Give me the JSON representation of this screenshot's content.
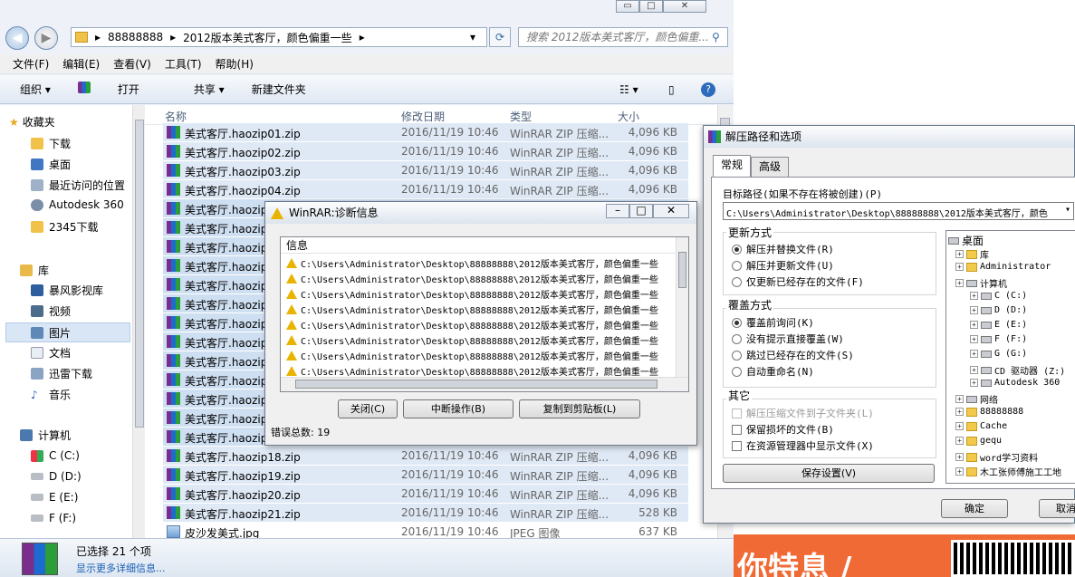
{
  "explorer": {
    "win_buttons": [
      "▭",
      "□",
      "✕"
    ],
    "address": [
      "88888888",
      "2012版本美式客厅，颜色偏重一些"
    ],
    "search_placeholder": "搜索 2012版本美式客厅，颜色偏重...",
    "menu": [
      "文件(F)",
      "编辑(E)",
      "查看(V)",
      "工具(T)",
      "帮助(H)"
    ],
    "toolbar": [
      "组织 ▾",
      "打开",
      "共享 ▾",
      "新建文件夹"
    ],
    "nav": {
      "favorites_label": "收藏夹",
      "favorites": [
        "下载",
        "桌面",
        "最近访问的位置",
        "Autodesk 360",
        "2345下载"
      ],
      "libraries_label": "库",
      "libraries": [
        "暴风影视库",
        "视频",
        "图片",
        "文档",
        "迅雷下载",
        "音乐"
      ],
      "computer_label": "计算机",
      "drives": [
        "C (C:)",
        "D (D:)",
        "E (E:)",
        "F (F:)"
      ]
    },
    "columns": [
      "名称",
      "修改日期",
      "类型",
      "大小"
    ],
    "files": [
      {
        "name": "美式客厅.haozip01.zip",
        "date": "2016/11/19 10:46",
        "type": "WinRAR ZIP 压缩...",
        "size": "4,096 KB"
      },
      {
        "name": "美式客厅.haozip02.zip",
        "date": "2016/11/19 10:46",
        "type": "WinRAR ZIP 压缩...",
        "size": "4,096 KB"
      },
      {
        "name": "美式客厅.haozip03.zip",
        "date": "2016/11/19 10:46",
        "type": "WinRAR ZIP 压缩...",
        "size": "4,096 KB"
      },
      {
        "name": "美式客厅.haozip04.zip",
        "date": "2016/11/19 10:46",
        "type": "WinRAR ZIP 压缩...",
        "size": "4,096 KB"
      },
      {
        "name": "美式客厅.haozip",
        "date": "",
        "type": "",
        "size": ""
      },
      {
        "name": "美式客厅.haozip",
        "date": "",
        "type": "",
        "size": ""
      },
      {
        "name": "美式客厅.haozip",
        "date": "",
        "type": "",
        "size": ""
      },
      {
        "name": "美式客厅.haozip",
        "date": "",
        "type": "",
        "size": ""
      },
      {
        "name": "美式客厅.haozip",
        "date": "",
        "type": "",
        "size": ""
      },
      {
        "name": "美式客厅.haozip",
        "date": "",
        "type": "",
        "size": ""
      },
      {
        "name": "美式客厅.haozip",
        "date": "",
        "type": "",
        "size": ""
      },
      {
        "name": "美式客厅.haozip",
        "date": "",
        "type": "",
        "size": ""
      },
      {
        "name": "美式客厅.haozip",
        "date": "",
        "type": "",
        "size": ""
      },
      {
        "name": "美式客厅.haozip",
        "date": "",
        "type": "",
        "size": ""
      },
      {
        "name": "美式客厅.haozip",
        "date": "",
        "type": "",
        "size": ""
      },
      {
        "name": "美式客厅.haozip",
        "date": "",
        "type": "",
        "size": ""
      },
      {
        "name": "美式客厅.haozip",
        "date": "",
        "type": "",
        "size": ""
      },
      {
        "name": "美式客厅.haozip18.zip",
        "date": "2016/11/19 10:46",
        "type": "WinRAR ZIP 压缩...",
        "size": "4,096 KB"
      },
      {
        "name": "美式客厅.haozip19.zip",
        "date": "2016/11/19 10:46",
        "type": "WinRAR ZIP 压缩...",
        "size": "4,096 KB"
      },
      {
        "name": "美式客厅.haozip20.zip",
        "date": "2016/11/19 10:46",
        "type": "WinRAR ZIP 压缩...",
        "size": "4,096 KB"
      },
      {
        "name": "美式客厅.haozip21.zip",
        "date": "2016/11/19 10:46",
        "type": "WinRAR ZIP 压缩...",
        "size": "528 KB"
      }
    ],
    "jpg": {
      "name": "皮沙发美式.jpg",
      "date": "2016/11/19 10:46",
      "type": "JPEG 图像",
      "size": "637 KB"
    },
    "status": {
      "selected": "已选择 21 个项",
      "details": "显示更多详细信息..."
    }
  },
  "diag": {
    "title": "WinRAR:诊断信息",
    "list_header": "信息",
    "message": "C:\\Users\\Administrator\\Desktop\\88888888\\2012版本美式客厅，颜色偏重一些",
    "message_count": 8,
    "buttons": [
      "关闭(C)",
      "中断操作(B)",
      "复制到剪贴板(L)"
    ],
    "status": "错误总数: 19"
  },
  "extract": {
    "title": "解压路径和选项",
    "tabs": [
      "常规",
      "高级"
    ],
    "target_label": "目标路径(如果不存在将被创建)(P)",
    "target_value": "C:\\Users\\Administrator\\Desktop\\88888888\\2012版本美式客厅，颜色",
    "update_label": "更新方式",
    "update_opts": [
      "解压并替换文件(R)",
      "解压并更新文件(U)",
      "仅更新已经存在的文件(F)"
    ],
    "overwrite_label": "覆盖方式",
    "overwrite_opts": [
      "覆盖前询问(K)",
      "没有提示直接覆盖(W)",
      "跳过已经存在的文件(S)",
      "自动重命名(N)"
    ],
    "misc_label": "其它",
    "misc_opts": [
      "解压压缩文件到子文件夹(L)",
      "保留损坏的文件(B)",
      "在资源管理器中显示文件(X)"
    ],
    "save_btn": "保存设置(V)",
    "tree": [
      "桌面",
      "库",
      "Administrator",
      "计算机",
      "C (C:)",
      "D (D:)",
      "E (E:)",
      "F (F:)",
      "G (G:)",
      "CD 驱动器 (Z:)",
      "Autodesk 360",
      "网络",
      "88888888",
      "Cache",
      "gequ",
      "word学习资料",
      "木工张师傅施工工地"
    ],
    "ok": "确定",
    "cancel": "取消"
  },
  "ad": {
    "text": "你特息 /"
  }
}
